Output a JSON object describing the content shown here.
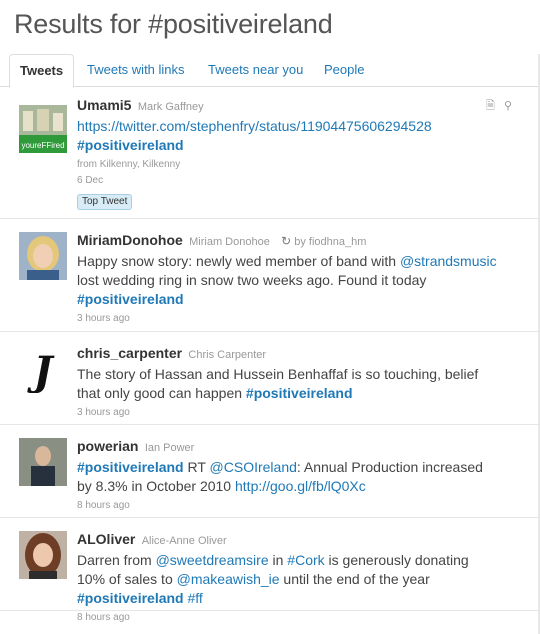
{
  "page": {
    "title": "Results for #positiveireland"
  },
  "tabs": [
    {
      "label": "Tweets",
      "active": true
    },
    {
      "label": "Tweets with links"
    },
    {
      "label": "Tweets near you"
    },
    {
      "label": "People"
    }
  ],
  "tweets": [
    {
      "screen_name": "Umami5",
      "full_name": "Mark Gaffney",
      "avatar_caption": "youreFFired",
      "link": "https://twitter.com/stephenfry/status/11904475606294528",
      "hashtag": "#positiveireland",
      "location": "from Kilkenny, Kilkenny",
      "time": "6 Dec",
      "badge": "Top Tweet",
      "icons": [
        "document-icon",
        "location-pin-icon"
      ]
    },
    {
      "screen_name": "MiriamDonohoe",
      "full_name": "Miriam Donohoe",
      "retweeted_by": "by fiodhna_hm",
      "text_1": "Happy snow story: newly wed member of band with ",
      "mention_1": "@strandsmusic",
      "text_2": "lost wedding ring in snow two weeks ago. Found it today",
      "hashtag": "#positiveireland",
      "time": "3 hours ago"
    },
    {
      "screen_name": "chris_carpenter",
      "full_name": "Chris Carpenter",
      "text_1": "The story of Hassan and Hussein Benhaffaf is so touching, belief",
      "text_2": "that only good can happen ",
      "hashtag": "#positiveireland",
      "time": "3 hours ago"
    },
    {
      "screen_name": "powerian",
      "full_name": "Ian Power",
      "hashtag": "#positiveireland",
      "text_1": " RT ",
      "mention_1": "@CSOIreland",
      "text_2": ": Annual Production increased",
      "text_3": "by 8.3% in October 2010 ",
      "link": "http://goo.gl/fb/lQ0Xc",
      "time": "8 hours ago"
    },
    {
      "screen_name": "ALOliver",
      "full_name": "Alice-Anne Oliver",
      "text_1": "Darren from ",
      "mention_1": "@sweetdreamsire",
      "text_2": " in ",
      "hashtag_1": "#Cork",
      "text_3": " is generously donating",
      "text_4": "10% of sales to ",
      "mention_2": "@makeawish_ie",
      "text_5": " until the end of the year",
      "hashtag": "#positiveireland",
      "hashtag_2": "#ff",
      "time": "8 hours ago"
    }
  ]
}
